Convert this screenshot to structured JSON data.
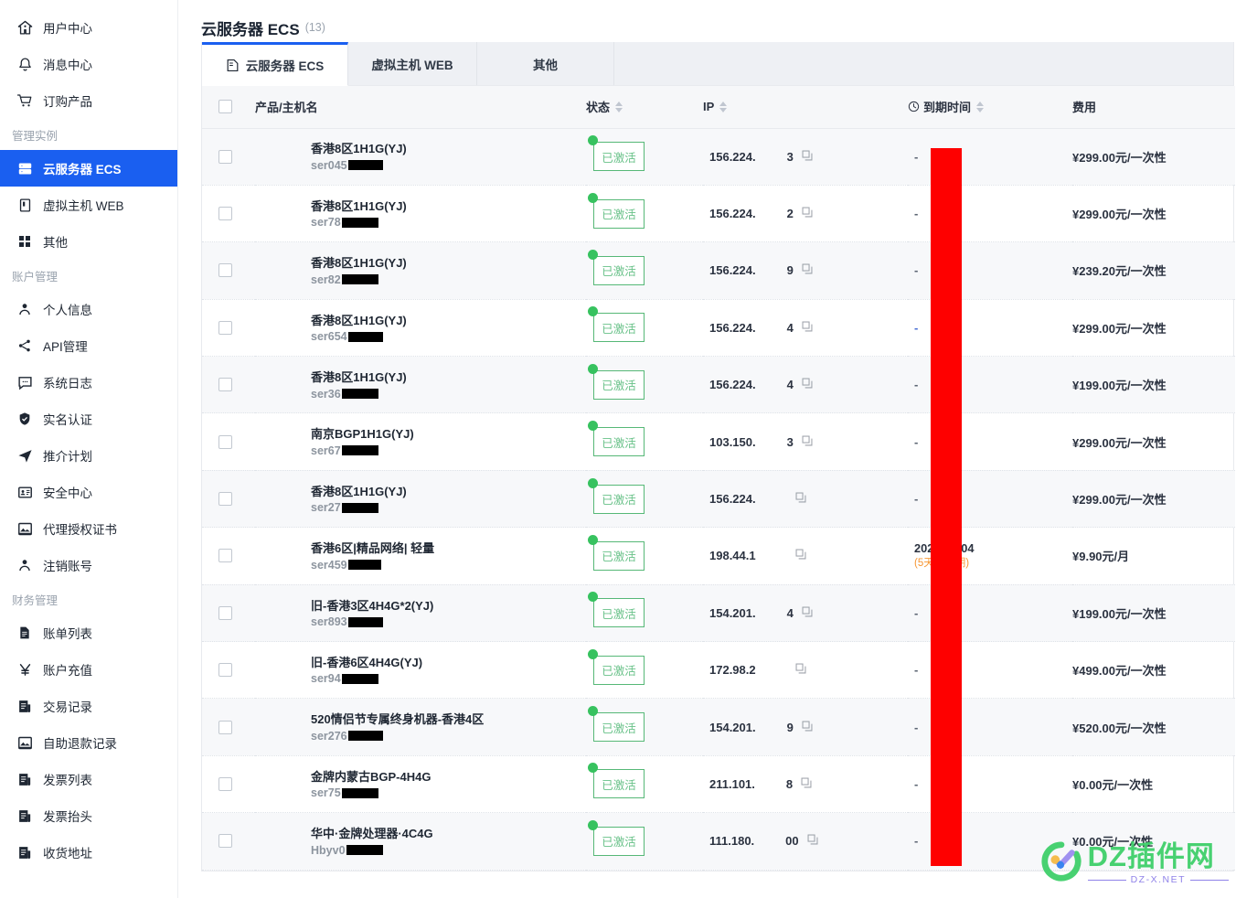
{
  "sidebar": {
    "top_items": [
      {
        "label": "用户中心",
        "icon": "home-icon"
      },
      {
        "label": "消息中心",
        "icon": "bell-icon"
      },
      {
        "label": "订购产品",
        "icon": "cart-icon"
      }
    ],
    "group_manage_label": "管理实例",
    "manage_items": [
      {
        "label": "云服务器 ECS",
        "icon": "server-icon",
        "active": true
      },
      {
        "label": "虚拟主机 WEB",
        "icon": "web-host-icon",
        "active": false
      },
      {
        "label": "其他",
        "icon": "grid-icon",
        "active": false
      }
    ],
    "group_account_label": "账户管理",
    "account_items": [
      {
        "label": "个人信息",
        "icon": "user-icon"
      },
      {
        "label": "API管理",
        "icon": "share-icon"
      },
      {
        "label": "系统日志",
        "icon": "message-icon"
      },
      {
        "label": "实名认证",
        "icon": "shield-icon"
      },
      {
        "label": "推介计划",
        "icon": "send-icon"
      },
      {
        "label": "安全中心",
        "icon": "id-card-icon"
      },
      {
        "label": "代理授权证书",
        "icon": "certificate-icon"
      },
      {
        "label": "注销账号",
        "icon": "user-icon"
      }
    ],
    "group_finance_label": "财务管理",
    "finance_items": [
      {
        "label": "账单列表",
        "icon": "document-icon"
      },
      {
        "label": "账户充值",
        "icon": "yen-icon"
      },
      {
        "label": "交易记录",
        "icon": "report-icon"
      },
      {
        "label": "自助退款记录",
        "icon": "refund-icon"
      },
      {
        "label": "发票列表",
        "icon": "report-icon"
      },
      {
        "label": "发票抬头",
        "icon": "report-icon"
      },
      {
        "label": "收货地址",
        "icon": "report-icon"
      }
    ]
  },
  "header": {
    "title": "云服务器 ECS",
    "count": "(13)"
  },
  "tabs": [
    {
      "label": "云服务器 ECS",
      "icon": "server-tab-icon",
      "active": true
    },
    {
      "label": "虚拟主机 WEB",
      "icon": "",
      "active": false
    },
    {
      "label": "其他",
      "icon": "",
      "active": false
    }
  ],
  "table": {
    "columns": [
      {
        "key": "checkbox",
        "label": "",
        "sortable": false
      },
      {
        "key": "name",
        "label": "产品/主机名",
        "sortable": false
      },
      {
        "key": "state",
        "label": "状态",
        "sortable": true
      },
      {
        "key": "ip",
        "label": "IP",
        "sortable": true
      },
      {
        "key": "expire",
        "label": "到期时间",
        "sortable": true,
        "icon": "clock-icon"
      },
      {
        "key": "fee",
        "label": "费用",
        "sortable": false
      }
    ],
    "rows": [
      {
        "name": "香港8区1H1G(YJ)",
        "host": "ser045",
        "host_redacted_w": 38,
        "state": "已激活",
        "ip": "156.224.",
        "ip_tail": "3",
        "expire": "-",
        "expire_note": "",
        "fee": "¥299.00元/一次性"
      },
      {
        "name": "香港8区1H1G(YJ)",
        "host": "ser78",
        "host_redacted_w": 40,
        "state": "已激活",
        "ip": "156.224.",
        "ip_tail": "2",
        "expire": "-",
        "expire_note": "",
        "fee": "¥299.00元/一次性"
      },
      {
        "name": "香港8区1H1G(YJ)",
        "host": "ser82",
        "host_redacted_w": 40,
        "state": "已激活",
        "ip": "156.224.",
        "ip_tail": "9",
        "expire": "-",
        "expire_note": "",
        "fee": "¥239.20元/一次性"
      },
      {
        "name": "香港8区1H1G(YJ)",
        "host": "ser654",
        "host_redacted_w": 38,
        "state": "已激活",
        "ip": "156.224.",
        "ip_tail": "4",
        "expire": "-",
        "expire_note": "",
        "fee": "¥299.00元/一次性",
        "dash_blue": true
      },
      {
        "name": "香港8区1H1G(YJ)",
        "host": "ser36",
        "host_redacted_w": 40,
        "state": "已激活",
        "ip": "156.224.",
        "ip_tail": "4",
        "expire": "-",
        "expire_note": "",
        "fee": "¥199.00元/一次性"
      },
      {
        "name": "南京BGP1H1G(YJ)",
        "host": "ser67",
        "host_redacted_w": 40,
        "state": "已激活",
        "ip": "103.150.",
        "ip_tail": "3",
        "expire": "-",
        "expire_note": "",
        "fee": "¥299.00元/一次性"
      },
      {
        "name": "香港8区1H1G(YJ)",
        "host": "ser27",
        "host_redacted_w": 40,
        "state": "已激活",
        "ip": "156.224.",
        "ip_tail": "",
        "expire": "-",
        "expire_note": "",
        "fee": "¥299.00元/一次性"
      },
      {
        "name": "香港6区|精品网络| 轻量",
        "host": "ser459",
        "host_redacted_w": 36,
        "state": "已激活",
        "ip": "198.44.1",
        "ip_tail": "",
        "expire": "2024-10-04",
        "expire_note": "(5天后到期)",
        "fee": "¥9.90元/月"
      },
      {
        "name": "旧-香港3区4H4G*2(YJ)",
        "host": "ser893",
        "host_redacted_w": 38,
        "state": "已激活",
        "ip": "154.201.",
        "ip_tail": "4",
        "expire": "-",
        "expire_note": "",
        "fee": "¥199.00元/一次性"
      },
      {
        "name": "旧-香港6区4H4G(YJ)",
        "host": "ser94",
        "host_redacted_w": 40,
        "state": "已激活",
        "ip": "172.98.2",
        "ip_tail": "",
        "expire": "-",
        "expire_note": "",
        "fee": "¥499.00元/一次性"
      },
      {
        "name": "520情侣节专属终身机器-香港4区",
        "host": "ser276",
        "host_redacted_w": 38,
        "state": "已激活",
        "ip": "154.201.",
        "ip_tail": "9",
        "expire": "-",
        "expire_note": "",
        "fee": "¥520.00元/一次性"
      },
      {
        "name": "金牌内蒙古BGP-4H4G",
        "host": "ser75",
        "host_redacted_w": 40,
        "state": "已激活",
        "ip": "211.101.",
        "ip_tail": "8",
        "expire": "-",
        "expire_note": "",
        "fee": "¥0.00元/一次性"
      },
      {
        "name": "华中·金牌处理器·4C4G",
        "host": "Hbyv0",
        "host_redacted_w": 40,
        "state": "已激活",
        "ip": "111.180.",
        "ip_tail": "00",
        "expire": "-",
        "expire_note": "",
        "fee": "¥0.00元/一次性"
      }
    ]
  },
  "watermark": {
    "main": "DZ插件网",
    "sub": "DZ-X.NET"
  },
  "colors": {
    "accent": "#1a5ff0",
    "status_green": "#37c25f",
    "status_border": "#56b877",
    "warn_orange": "#f79633",
    "censor_red": "#fe0000",
    "watermark_green": "#3fcf6a",
    "watermark_purple": "#8a7ce8"
  }
}
